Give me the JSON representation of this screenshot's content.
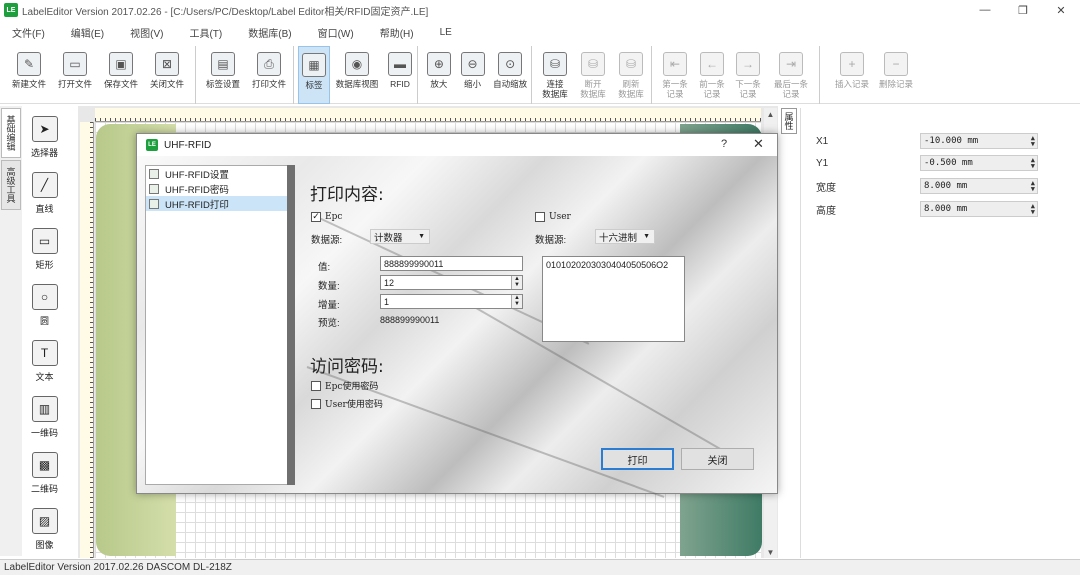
{
  "app": {
    "title": "LabelEditor Version 2017.02.26 - [C:/Users/PC/Desktop/Label Editor相关/RFID固定资产.LE]",
    "window_controls": [
      "—",
      "❐",
      "✕"
    ]
  },
  "menu": [
    "文件(F)",
    "编辑(E)",
    "视图(V)",
    "工具(T)",
    "数据库(B)",
    "窗口(W)",
    "帮助(H)",
    "LE"
  ],
  "toolbar": {
    "file": [
      {
        "label": "新建文件",
        "icon": "new-file-icon"
      },
      {
        "label": "打开文件",
        "icon": "open-file-icon"
      },
      {
        "label": "保存文件",
        "icon": "save-file-icon"
      },
      {
        "label": "关闭文件",
        "icon": "close-file-icon"
      }
    ],
    "print": [
      {
        "label": "标签设置",
        "icon": "label-settings-icon"
      },
      {
        "label": "打印文件",
        "icon": "print-icon"
      }
    ],
    "view": [
      {
        "label": "标签",
        "icon": "label-view-icon",
        "active": true
      },
      {
        "label": "数据库视图",
        "icon": "database-view-icon"
      },
      {
        "label": "RFID",
        "icon": "rfid-icon"
      }
    ],
    "zoom": [
      {
        "label": "放大",
        "icon": "zoom-in-icon"
      },
      {
        "label": "缩小",
        "icon": "zoom-out-icon"
      },
      {
        "label": "自动缩放",
        "icon": "zoom-auto-icon"
      }
    ],
    "db": [
      {
        "label": "连接\n数据库",
        "icon": "db-connect-icon"
      },
      {
        "label": "断开\n数据库",
        "icon": "db-disconnect-icon",
        "disabled": true
      },
      {
        "label": "刷新\n数据库",
        "icon": "db-refresh-icon",
        "disabled": true
      }
    ],
    "records": [
      {
        "label": "第一条\n记录",
        "icon": "first-record-icon",
        "disabled": true
      },
      {
        "label": "前一条\n记录",
        "icon": "prev-record-icon",
        "disabled": true
      },
      {
        "label": "下一条\n记录",
        "icon": "next-record-icon",
        "disabled": true
      },
      {
        "label": "最后一条\n记录",
        "icon": "last-record-icon",
        "disabled": true
      }
    ],
    "edit_records": [
      {
        "label": "插入记录",
        "icon": "insert-record-icon",
        "disabled": true
      },
      {
        "label": "删除记录",
        "icon": "delete-record-icon",
        "disabled": true
      }
    ]
  },
  "side_tabs": [
    "基础编辑",
    "高级工具"
  ],
  "tools": [
    {
      "label": "选择器",
      "icon": "selector-arrow-icon"
    },
    {
      "label": "直线",
      "icon": "line-icon"
    },
    {
      "label": "矩形",
      "icon": "rectangle-icon"
    },
    {
      "label": "圆",
      "icon": "circle-icon"
    },
    {
      "label": "文本",
      "icon": "text-icon"
    },
    {
      "label": "一维码",
      "icon": "barcode-icon"
    },
    {
      "label": "二维码",
      "icon": "qrcode-icon"
    },
    {
      "label": "图像",
      "icon": "image-icon"
    }
  ],
  "properties": {
    "tab": "属性",
    "rows": [
      {
        "name": "X1",
        "value": "-10.000 mm"
      },
      {
        "name": "Y1",
        "value": "-0.500 mm"
      },
      {
        "name": "宽度",
        "value": "8.000 mm"
      },
      {
        "name": "高度",
        "value": "8.000 mm"
      }
    ]
  },
  "status": "LabelEditor Version 2017.02.26 DASCOM DL-218Z",
  "dialog": {
    "title": "UHF-RFID",
    "help": "?",
    "close": "✕",
    "nav": [
      {
        "label": "UHF-RFID设置"
      },
      {
        "label": "UHF-RFID密码"
      },
      {
        "label": "UHF-RFID打印",
        "selected": true
      }
    ],
    "print_content_title": "打印内容:",
    "epc": {
      "checkbox_label": "Epc",
      "checked": true,
      "source_label": "数据源:",
      "source_value": "计数器",
      "value_label": "值:",
      "value": "888899990011",
      "count_label": "数量:",
      "count": "12",
      "increment_label": "增量:",
      "increment": "1",
      "preview_label": "预览:",
      "preview": "888899990011"
    },
    "user": {
      "checkbox_label": "User",
      "checked": false,
      "source_label": "数据源:",
      "source_value": "十六进制",
      "data": "0101020203030404050506O2"
    },
    "password_title": "访问密码:",
    "epc_password_label": "Epc使用密码",
    "user_password_label": "User使用密码",
    "print_button": "打印",
    "close_button": "关闭"
  }
}
